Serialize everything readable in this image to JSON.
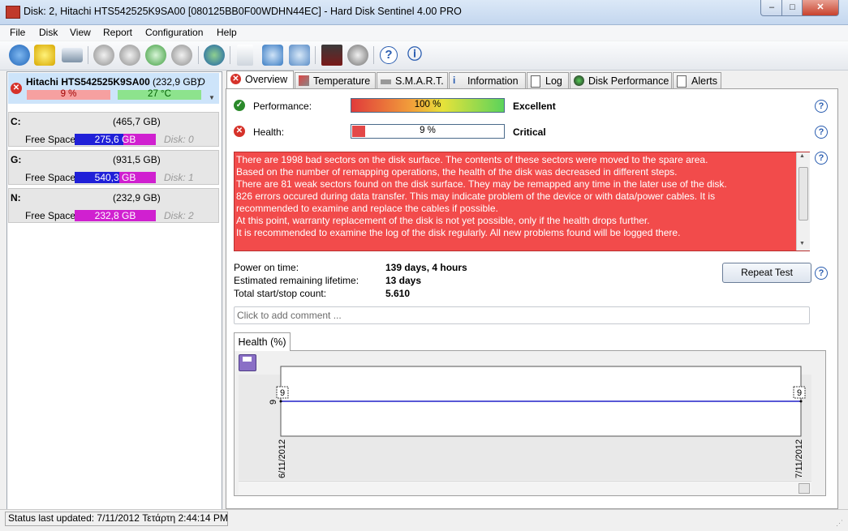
{
  "window": {
    "title": "Disk: 2, Hitachi HTS542525K9SA00 [080125BB0F00WDHN44EC]  -  Hard Disk Sentinel 4.00 PRO",
    "btn_min": "–",
    "btn_max": "□",
    "btn_close": "✕"
  },
  "menu": [
    "File",
    "Disk",
    "View",
    "Report",
    "Configuration",
    "Help"
  ],
  "toolbar": {
    "icons": [
      "refresh-icon",
      "alert-icon",
      "disk-drive-icon",
      "disk-check-icon",
      "disk-test-icon",
      "disk-ok-icon",
      "disk-repair-icon",
      "internet-update-icon",
      "report-icon",
      "send-report-icon",
      "network-icon",
      "tools-icon",
      "sound-icon",
      "help-icon",
      "info-icon"
    ]
  },
  "disk_panel": {
    "selected_disk": {
      "name": "Hitachi HTS542525K9SA00",
      "size": "(232,9 GB)",
      "suffix": "D",
      "health": "9 %",
      "health_value": 9,
      "temperature": "27 °C"
    },
    "drives": [
      {
        "letter": "C:",
        "size": "(465,7 GB)",
        "free_label": "Free Space",
        "free": "275,6 GB",
        "disk": "Disk: 0",
        "color": "#2020d8",
        "accent": "#d020d0",
        "fill_fraction": 0.6
      },
      {
        "letter": "G:",
        "size": "(931,5 GB)",
        "free_label": "Free Space",
        "free": "540,3 GB",
        "disk": "Disk: 1",
        "color": "#2020d8",
        "accent": "#d020d0",
        "fill_fraction": 0.45
      },
      {
        "letter": "N:",
        "size": "(232,9 GB)",
        "free_label": "Free Space",
        "free": "232,8 GB",
        "disk": "Disk: 2",
        "color": "#d020d0",
        "accent": "#d020d0",
        "fill_fraction": 0.0
      }
    ]
  },
  "tabs": [
    "Overview",
    "Temperature",
    "S.M.A.R.T.",
    "Information",
    "Log",
    "Disk Performance",
    "Alerts"
  ],
  "overview": {
    "performance_label": "Performance:",
    "performance_value": "100 %",
    "performance_level": 100,
    "performance_status": "Excellent",
    "health_label": "Health:",
    "health_value": "9 %",
    "health_level": 9,
    "health_status": "Critical",
    "messages": [
      "There are 1998 bad sectors on the disk surface. The contents of these sectors were moved to the spare area.",
      "Based on the number of remapping operations, the health of the disk was decreased in different steps.",
      "There are 81 weak sectors found on the disk surface. They may be remapped any time in the later use of the disk.",
      "826 errors occured during data transfer. This may indicate problem of the device or with data/power cables. It is",
      "recommended to examine and replace the cables if possible.",
      "At this point, warranty replacement of the disk is not yet possible, only if the health drops further.",
      "It is recommended to examine the log of the disk regularly. All new problems found will be logged there."
    ],
    "power_on_label": "Power on time:",
    "power_on_value": "139 days, 4 hours",
    "lifetime_label": "Estimated remaining lifetime:",
    "lifetime_value": "13 days",
    "startstop_label": "Total start/stop count:",
    "startstop_value": "5.610",
    "repeat_button": "Repeat Test",
    "comment_placeholder": "Click to add comment ...",
    "chart_tab": "Health (%)"
  },
  "chart_data": {
    "type": "line",
    "x": [
      "6/11/2012",
      "7/11/2012"
    ],
    "series": [
      {
        "values": [
          9,
          9
        ]
      }
    ],
    "data_labels": [
      "9",
      "9"
    ],
    "y_tick": "9",
    "ylim": [
      0,
      18
    ],
    "line_color": "#2020c8",
    "grid": false
  },
  "status": {
    "text": "Status last updated: 7/11/2012 Τετάρτη 2:44:14 PM"
  }
}
